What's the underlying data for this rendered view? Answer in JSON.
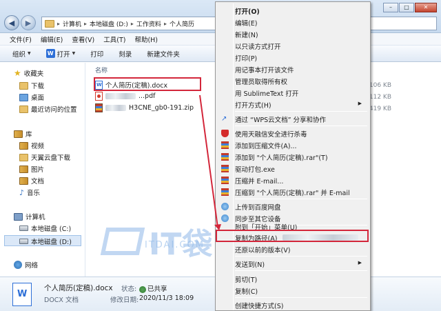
{
  "address": {
    "crumbs": [
      "计算机",
      "本地磁盘 (D:)",
      "工作资料",
      "个人简历"
    ]
  },
  "window": {
    "minimize": "–",
    "maximize": "□",
    "close": "✕"
  },
  "menubar": [
    "文件(F)",
    "编辑(E)",
    "查看(V)",
    "工具(T)",
    "帮助(H)"
  ],
  "toolbar": {
    "organize": "组织",
    "open": "打开",
    "print": "打印",
    "burn": "刻录",
    "new_folder": "新建文件夹"
  },
  "nav": {
    "favorites": "收藏夹",
    "downloads": "下载",
    "desktop": "桌面",
    "recent": "最近访问的位置",
    "library": "库",
    "videos": "视频",
    "tianyi": "天翼云盘下载",
    "pictures": "图片",
    "documents": "文档",
    "music": "音乐",
    "computer": "计算机",
    "drive_c": "本地磁盘 (C:)",
    "drive_d": "本地磁盘 (D:)",
    "network": "网络"
  },
  "filelist": {
    "col_name": "名称",
    "files": [
      {
        "name": "个人简历(定稿).docx",
        "size": "106 KB",
        "type": "docx"
      },
      {
        "name": "...pdf",
        "size": "112 KB",
        "type": "pdf"
      },
      {
        "name": "H3CNE_gb0-191.zip",
        "size": "419 KB",
        "type": "zip"
      }
    ]
  },
  "watermark": {
    "brand": "IT袋",
    "url": "ITDAI.COM"
  },
  "details": {
    "icon_letter": "W",
    "filename": "个人简历(定稿).docx",
    "filetype": "DOCX 文档",
    "state_label": "状态:",
    "state_value": "已共享",
    "modified_label": "修改日期:",
    "modified_value": "2020/11/3 18:09"
  },
  "context_menu": {
    "open": "打开(O)",
    "edit": "编辑(E)",
    "new": "新建(N)",
    "open_readonly": "以只读方式打开",
    "print": "打印(P)",
    "notepad": "用记事本打开该文件",
    "admin": "管理员取得所有权",
    "sublime": "用 SublimeText 打开",
    "open_with": "打开方式(H)",
    "wps_share": "通过 “WPS云文档” 分享和协作",
    "tencent": "使用天融信安全进行杀毒",
    "add_archive": "添加到压缩文件(A)...",
    "add_rar": "添加到 \"个人简历(定稿).rar\"(T)",
    "drive_pack": "驱动打包.exe",
    "compress_email": "压缩并 E-mail...",
    "compress_rar_email": "压缩到 \"个人简历(定稿).rar\" 并 E-mail",
    "baidu": "上传到百度网盘",
    "sync": "同步至其它设备",
    "pin_start": "附到「开始」菜单(U)",
    "copy_path": "复制为路径(A)",
    "restore": "还原以前的版本(V)",
    "send_to": "发送到(N)",
    "cut": "剪切(T)",
    "copy": "复制(C)",
    "shortcut": "创建快捷方式(S)"
  }
}
